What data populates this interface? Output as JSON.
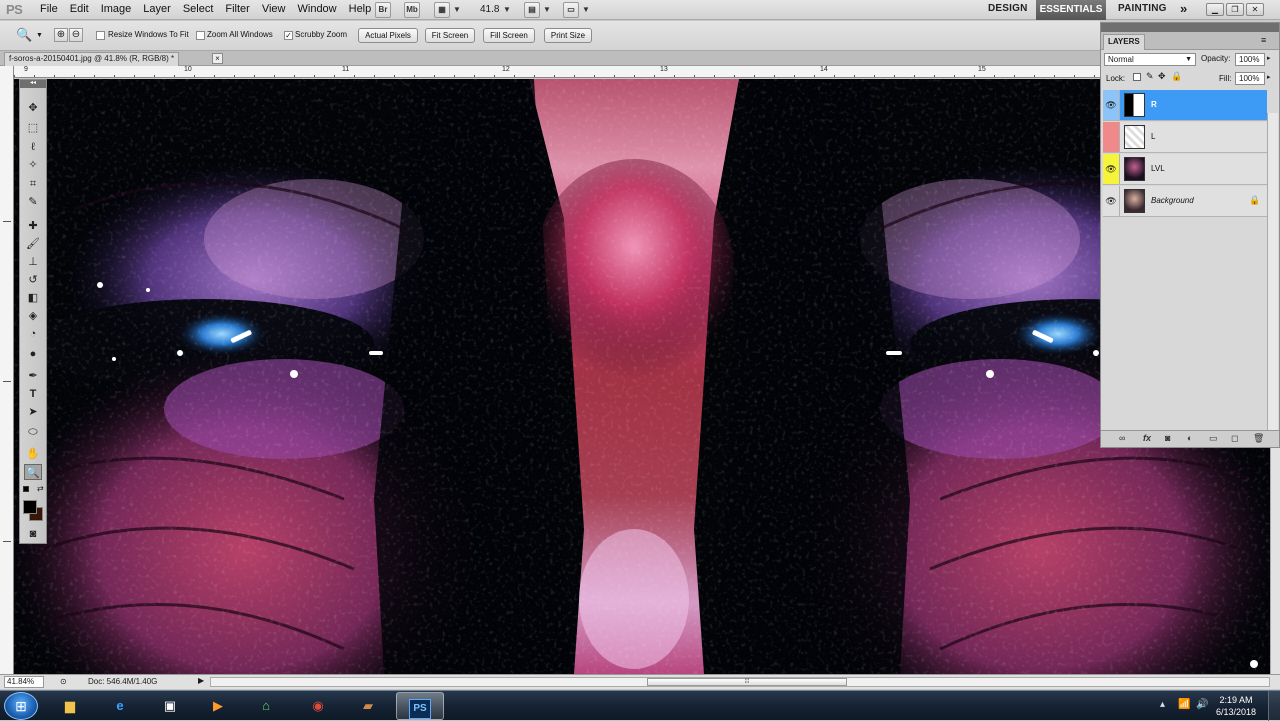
{
  "app": {
    "logo": "PS"
  },
  "menu": [
    "File",
    "Edit",
    "Image",
    "Layer",
    "Select",
    "Filter",
    "View",
    "Window",
    "Help"
  ],
  "menubar_right": {
    "bridge_label": "Br",
    "minibridge_label": "Mb",
    "zoom_value": "41.8",
    "workspaces": [
      "DESIGN",
      "ESSENTIALS",
      "PAINTING"
    ],
    "more_label": "»"
  },
  "options": {
    "resize_windows_to_fit": "Resize Windows To Fit",
    "zoom_all_windows": "Zoom All Windows",
    "scrubby_zoom": "Scrubby Zoom",
    "scrubby_checked": "✓",
    "actual_pixels": "Actual Pixels",
    "fit_screen": "Fit Screen",
    "fill_screen": "Fill Screen",
    "print_size": "Print Size"
  },
  "document": {
    "tab_title": "f-soros-a-20150401.jpg @ 41.8% (R, RGB/8) *",
    "close": "×",
    "zoom": "41.84%",
    "doc_info": "Doc: 546.4M/1.40G"
  },
  "ruler": {
    "top_labels": [
      "9",
      "10",
      "11",
      "12",
      "13",
      "14",
      "15"
    ]
  },
  "layers_panel": {
    "title": "LAYERS",
    "blend_mode": "Normal",
    "opacity_label": "Opacity:",
    "opacity_value": "100%",
    "lock_label": "Lock:",
    "fill_label": "Fill:",
    "fill_value": "100%",
    "layers": [
      {
        "name": "R",
        "color_tag": "#3e9bf5",
        "selected": true
      },
      {
        "name": "L",
        "color_tag": "#f08a8a",
        "selected": false
      },
      {
        "name": "LVL",
        "color_tag": "#f5f33a",
        "selected": false
      },
      {
        "name": "Background",
        "color_tag": "",
        "selected": false,
        "locked": true
      }
    ]
  },
  "taskbar": {
    "time": "2:19 AM",
    "date": "6/13/2018"
  },
  "colors": {
    "selected_layer": "#3e9bf5",
    "layer_red_tag": "#f08a8a",
    "layer_yellow_tag": "#f5f33a",
    "canvas_bg": "#020408"
  }
}
